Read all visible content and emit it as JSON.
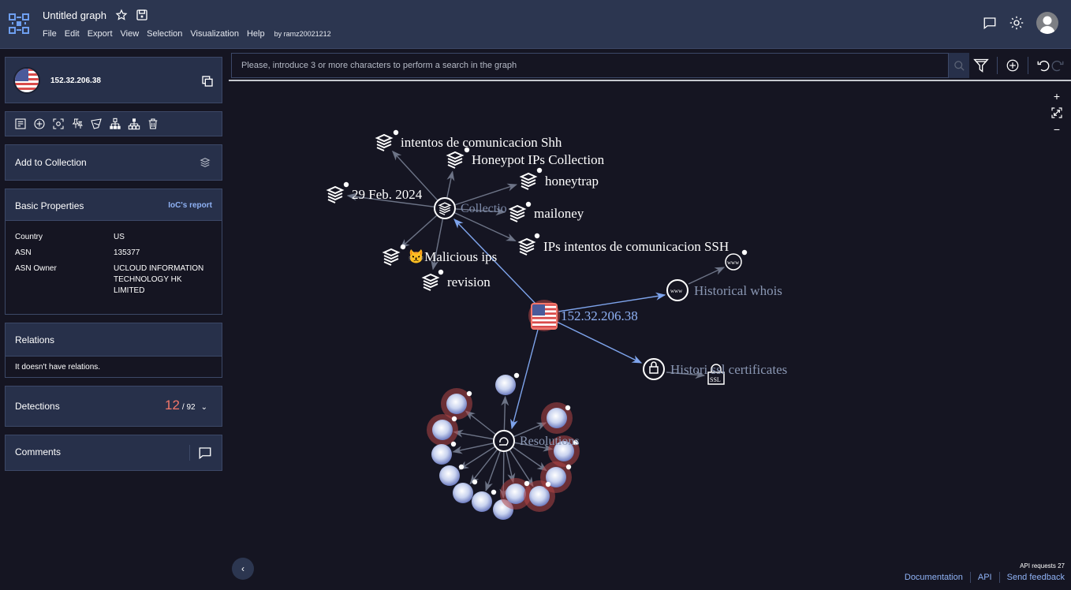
{
  "header": {
    "title": "Untitled graph",
    "menu": [
      "File",
      "Edit",
      "Export",
      "View",
      "Selection",
      "Visualization",
      "Help"
    ],
    "owner": "by ramz20021212",
    "icons": [
      "logo-icon",
      "star-icon",
      "save-icon",
      "chat-icon",
      "theme-sun-icon",
      "user-avatar"
    ]
  },
  "sidebar": {
    "node": {
      "ip": "152.32.206.38",
      "flag": "US"
    },
    "tools": [
      "notes-icon",
      "add-node-icon",
      "focus-icon",
      "pin-icon",
      "select-icon",
      "expand-tree-icon",
      "collapse-tree-icon",
      "delete-icon"
    ],
    "add_collection": "Add to Collection",
    "basic_properties": {
      "title": "Basic Properties",
      "link": "IoC's report",
      "rows": [
        {
          "key": "Country",
          "value": "US"
        },
        {
          "key": "ASN",
          "value": "135377"
        },
        {
          "key": "ASN Owner",
          "value": "UCLOUD INFORMATION TECHNOLOGY HK LIMITED"
        }
      ]
    },
    "relations": {
      "title": "Relations",
      "empty": "It doesn't have relations."
    },
    "detections": {
      "title": "Detections",
      "positives": "12",
      "total": "/ 92"
    },
    "comments": {
      "title": "Comments"
    }
  },
  "search": {
    "placeholder": "Please, introduce 3 or more characters to perform a search in the graph"
  },
  "graph": {
    "main_node": "152.32.206.38",
    "collection_hub": "Collectio",
    "collections": [
      "intentos de comunicacion Shh",
      "Honeypot IPs Collection",
      "honeytrap",
      "29 Feb. 2024",
      "mailoney",
      "IPs intentos de comunicacion SSH",
      "😾Malicious ips",
      "revision"
    ],
    "whois_hub": "Historical whois",
    "ssl_hub": "Histori    ssl certificates",
    "ssl_leaf": "SSL",
    "resolutions_hub": "Resolutions"
  },
  "footer": {
    "api_requests": "API requests 27",
    "links": [
      "Documentation",
      "API",
      "Send feedback"
    ]
  }
}
